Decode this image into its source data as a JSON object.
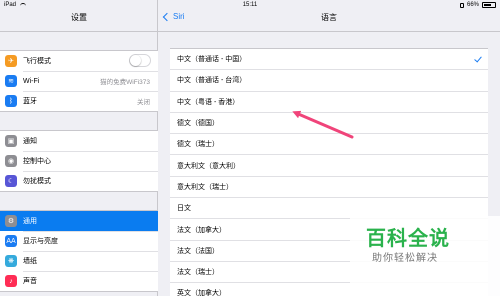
{
  "status_bar": {
    "carrier": "iPad",
    "time": "15:11",
    "battery": "66%",
    "battery_level": 0.66
  },
  "left_pane": {
    "title": "设置",
    "groups": [
      [
        {
          "label": "飞行模式",
          "icon": "airplane-icon",
          "icon_glyph": "✈",
          "color": "#f59b23",
          "control": "toggle",
          "toggle_on": false
        },
        {
          "label": "Wi-Fi",
          "icon": "wifi-icon",
          "icon_glyph": "≋",
          "color": "#1a7cf2",
          "value": "猫的免费WiFi373"
        },
        {
          "label": "蓝牙",
          "icon": "bluetooth-icon",
          "icon_glyph": "ᛒ",
          "color": "#1a7cf2",
          "value": "关闭"
        }
      ],
      [
        {
          "label": "通知",
          "icon": "notifications-icon",
          "icon_glyph": "▣",
          "color": "#8e8e93"
        },
        {
          "label": "控制中心",
          "icon": "control-center-icon",
          "icon_glyph": "◉",
          "color": "#8e8e93"
        },
        {
          "label": "勿扰模式",
          "icon": "moon-icon",
          "icon_glyph": "☾",
          "color": "#5856d6"
        }
      ],
      [
        {
          "label": "通用",
          "icon": "gear-icon",
          "icon_glyph": "⚙",
          "color": "#8e8e93",
          "selected": true
        },
        {
          "label": "显示与亮度",
          "icon": "display-icon",
          "icon_glyph": "AA",
          "color": "#1a7cf2"
        },
        {
          "label": "墙纸",
          "icon": "wallpaper-icon",
          "icon_glyph": "❋",
          "color": "#35aadc"
        },
        {
          "label": "声音",
          "icon": "sound-icon",
          "icon_glyph": "♪",
          "color": "#ff2d55"
        }
      ]
    ]
  },
  "right_pane": {
    "back_label": "Siri",
    "title": "语言",
    "languages": [
      {
        "label": "中文（普通话 - 中国）",
        "checked": true
      },
      {
        "label": "中文（普通话 - 台湾）"
      },
      {
        "label": "中文（粤语 - 香港）"
      },
      {
        "label": "德文（德国）"
      },
      {
        "label": "德文（瑞士）"
      },
      {
        "label": "意大利文（意大利）"
      },
      {
        "label": "意大利文（瑞士）"
      },
      {
        "label": "日文"
      },
      {
        "label": "法文（加拿大）"
      },
      {
        "label": "法文（法国）"
      },
      {
        "label": "法文（瑞士）"
      },
      {
        "label": "英文（加拿大）"
      }
    ]
  },
  "colors": {
    "accent": "#1a7cf2",
    "selected_row": "#0a7cf0",
    "annotation": "#f0447a",
    "watermark": "#2ab24c"
  },
  "watermark": {
    "title": "百科全说",
    "subtitle": "助你轻松解决"
  }
}
